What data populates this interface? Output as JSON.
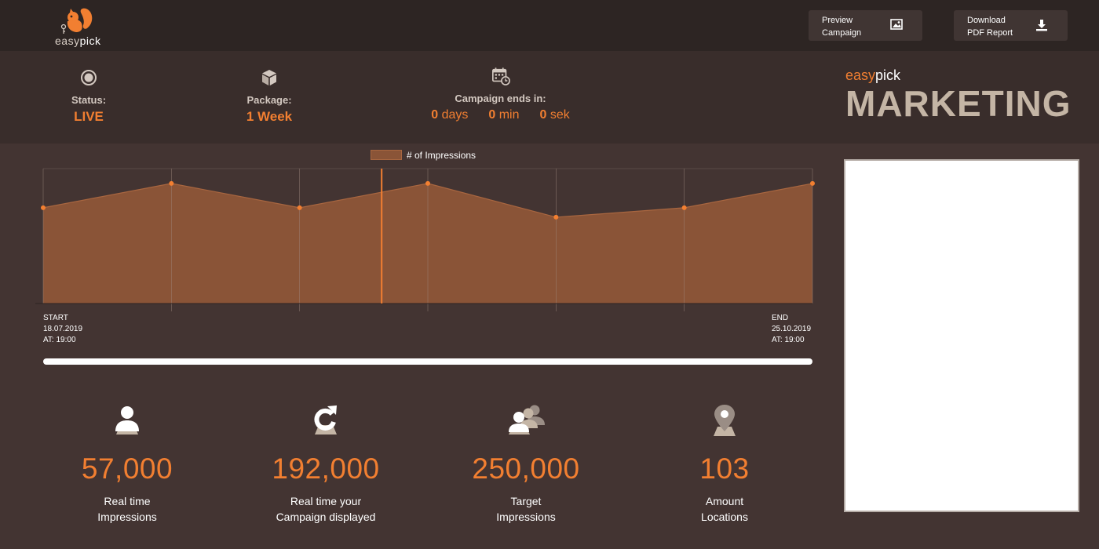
{
  "logo": {
    "text_easy": "easy",
    "text_pick": "pick",
    "icon": "squirrel-logo"
  },
  "header": {
    "preview_label": "Preview\nCampaign",
    "preview_icon": "image-icon",
    "download_label": "Download\nPDF Report",
    "download_icon": "download-icon"
  },
  "status": {
    "status_label": "Status:",
    "status_value": "LIVE",
    "package_label": "Package:",
    "package_value": "1 Week",
    "ends_label": "Campaign ends in:",
    "days_value": "0",
    "days_unit": " days",
    "min_value": "0",
    "min_unit": " min",
    "sec_value": "0",
    "sec_unit": " sek"
  },
  "brand": {
    "small_easy": "easy",
    "small_pick": "pick",
    "big": "MARKETING"
  },
  "chart_data": {
    "type": "area",
    "legend": [
      "# of Impressions"
    ],
    "series": [
      {
        "name": "# of Impressions",
        "values": [
          71,
          89,
          71,
          89,
          64,
          71,
          89
        ]
      }
    ],
    "ylim": [
      0,
      100
    ],
    "grid": "vertical",
    "marker_position": 0.44,
    "start": {
      "title": "START",
      "date": "18.07.2019",
      "time": "AT: 19:00"
    },
    "end": {
      "title": "END",
      "date": "25.10.2019",
      "time": "AT: 19:00"
    },
    "colors": {
      "fill": "#8a5437",
      "line": "#a86640",
      "point": "#f27f31",
      "marker": "#f27f31"
    }
  },
  "axis": {
    "start_text": "START\n18.07.2019\nAT: 19:00",
    "end_text": "END\n25.10.2019\nAT: 19:00"
  },
  "progress": {
    "fraction": 1.0
  },
  "metrics": [
    {
      "icon": "user-icon",
      "value": "57,000",
      "label": "Real time\nImpressions"
    },
    {
      "icon": "refresh-icon",
      "value": "192,000",
      "label": "Real time your\nCampaign displayed"
    },
    {
      "icon": "users-group-icon",
      "value": "250,000",
      "label": "Target\nImpressions"
    },
    {
      "icon": "location-pin-icon",
      "value": "103",
      "label": "Amount\nLocations"
    }
  ],
  "colors": {
    "accent": "#f27f31",
    "background": "#433432",
    "topbar": "#2d2523",
    "statusbar": "#392d2b"
  }
}
